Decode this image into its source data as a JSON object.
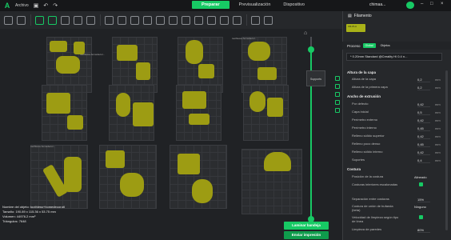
{
  "app": {
    "logo": "A",
    "menu_label": "Archivo"
  },
  "tabs": [
    {
      "label": "Preparar",
      "active": true
    },
    {
      "label": "Previsualización",
      "active": false
    },
    {
      "label": "Dispositivo",
      "active": false
    }
  ],
  "user": {
    "name": "chimaa..."
  },
  "filament": {
    "title": "Filamento",
    "swatch_label": "CR-PLA"
  },
  "process": {
    "title": "Proceso",
    "chip_global": "Global",
    "chip_objects": "Objetos",
    "preset": "* 0.20mm Standard @Creality Hi 0.4 n..."
  },
  "settings": {
    "cat_layer": "Altura de la capa",
    "cat_width": "Ancho de extrusión",
    "cat_seam": "Costura",
    "rows_layer": [
      {
        "label": "Altura de la capa",
        "value": "0,2",
        "unit": "mm"
      },
      {
        "label": "Altura de la primera capa",
        "value": "0,2",
        "unit": "mm"
      }
    ],
    "rows_width": [
      {
        "label": "Por defecto",
        "value": "0,42",
        "unit": "mm"
      },
      {
        "label": "Capa inicial",
        "value": "0,5",
        "unit": "mm"
      },
      {
        "label": "Perímetro externo",
        "value": "0,42",
        "unit": "mm"
      },
      {
        "label": "Perímetro interno",
        "value": "0,45",
        "unit": "mm"
      },
      {
        "label": "Relleno sólido superior",
        "value": "0,42",
        "unit": "mm"
      },
      {
        "label": "Relleno poco denso",
        "value": "0,45",
        "unit": "mm"
      },
      {
        "label": "Relleno sólido interno",
        "value": "0,42",
        "unit": "mm"
      },
      {
        "label": "Soportes",
        "value": "0,4",
        "unit": "mm"
      }
    ],
    "rows_seam": [
      {
        "label": "Posición de la costura",
        "select": "Alineado"
      },
      {
        "label": "Costuras interiores escalonadas",
        "check": true
      },
      {
        "label": "Separación entre costuras",
        "value": "15%"
      },
      {
        "label": "Costura de unión de bufanda (beta)",
        "select": "Ninguno"
      },
      {
        "label": "Velocidad de limpieza según tipo de línea",
        "check": true
      },
      {
        "label": "Limpieza de paredes",
        "value": "80%"
      }
    ]
  },
  "viewport": {
    "plate_labels": [
      "toothless+homedecor...",
      "toothless+homedecor...",
      "toothless+homedecor..."
    ],
    "supports_label": "Supports"
  },
  "object_info": {
    "name": "Nombre del objeto: toothless+homedecor.stl",
    "size": "Tamaño: 190.89 x 115.36 x 53.75 mm",
    "volume": "Volumen: 44976.2 mm³",
    "triangles": "Triángulos: 7648"
  },
  "buttons": {
    "slice": "Laminar bandeja",
    "send": "Enviar impresión"
  },
  "colors": {
    "accent": "#17c964",
    "part": "#9d9c13",
    "bg": "#1e2023"
  },
  "icons": [
    "logo-icon",
    "save-icon",
    "undo-icon",
    "redo-icon",
    "home-icon",
    "cloud-icon"
  ]
}
